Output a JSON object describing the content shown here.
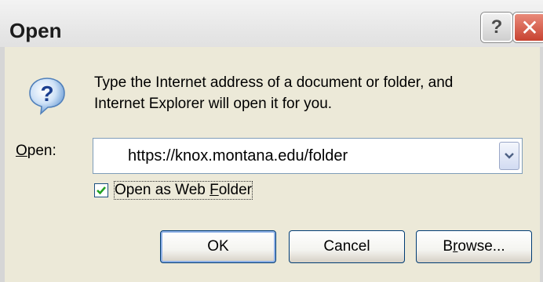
{
  "window": {
    "title": "Open"
  },
  "title_buttons": {
    "help_glyph": "?",
    "close_glyph": "✕"
  },
  "icons": {
    "title_help": "help-icon",
    "title_close": "close-icon",
    "dialog_icon": "question-bubble-icon",
    "dropdown": "chevron-down-icon",
    "checkmark": "checkmark-icon"
  },
  "message": {
    "line1": "Type the Internet address of a document or folder, and",
    "line2": "Internet Explorer will open it for you."
  },
  "open_field": {
    "label_mnemonic": "O",
    "label_rest": "pen:",
    "value": "https://knox.montana.edu/folder"
  },
  "web_folder_checkbox": {
    "checked": true,
    "label_part1": "Open as Web ",
    "label_mnemonic": "F",
    "label_part2": "older"
  },
  "buttons": {
    "ok": "OK",
    "cancel": "Cancel",
    "browse_part1": "B",
    "browse_mnemonic": "r",
    "browse_part2": "owse..."
  },
  "colors": {
    "dialog_background": "#ece9d8",
    "close_button": "#c84331",
    "checkmark": "#21a121",
    "default_button_ring": "#8eb0e6"
  }
}
